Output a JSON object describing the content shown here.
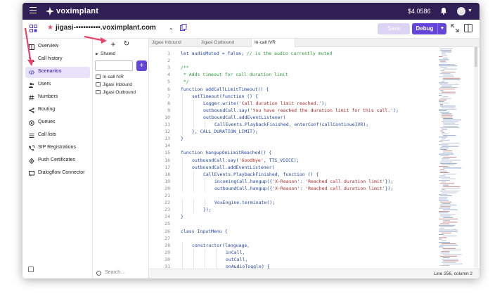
{
  "topbar": {
    "logo_text": "voximplant",
    "balance": "$4.0586"
  },
  "subbar": {
    "app_name": "jigasi-••••••••••.voximplant.com",
    "save_label": "Save",
    "debug_label": "Debug"
  },
  "sidebar": {
    "items": [
      {
        "label": "Overview",
        "icon": "overview-icon"
      },
      {
        "label": "Call history",
        "icon": "phone-icon"
      },
      {
        "label": "Scenarios",
        "icon": "code-icon",
        "active": true
      },
      {
        "label": "Users",
        "icon": "users-icon"
      },
      {
        "label": "Numbers",
        "icon": "numbers-icon"
      },
      {
        "label": "Routing",
        "icon": "routing-icon"
      },
      {
        "label": "Queues",
        "icon": "queues-icon"
      },
      {
        "label": "Call lists",
        "icon": "list-icon"
      },
      {
        "label": "SIP Registrations",
        "icon": "sip-icon"
      },
      {
        "label": "Push Certificates",
        "icon": "certificate-icon"
      },
      {
        "label": "Dialogflow Connector",
        "icon": "dialogflow-icon"
      }
    ]
  },
  "filetree": {
    "folder": "Shared",
    "files": [
      "In-call IVR",
      "Jigasi Inbound",
      "Jigasi Outbound"
    ],
    "search_placeholder": "Search..."
  },
  "tabs": [
    {
      "label": "Jigasi Inbound"
    },
    {
      "label": "Jigasi Outbound"
    },
    {
      "label": "In-call IVR",
      "active": true
    }
  ],
  "editor": {
    "lines": [
      {
        "n": "1",
        "indent": 0,
        "text": "let audioMuted = false; // is the audio currently muted"
      },
      {
        "n": "2",
        "indent": 0,
        "text": ""
      },
      {
        "n": "3",
        "indent": 0,
        "text": "/**"
      },
      {
        "n": "4",
        "indent": 0,
        "text": " * Adds timeout for call duration limit"
      },
      {
        "n": "5",
        "indent": 0,
        "text": " */"
      },
      {
        "n": "6",
        "indent": 0,
        "text": "function addCallLimitTimeout() {"
      },
      {
        "n": "7",
        "indent": 1,
        "text": "setTimeout(function () {"
      },
      {
        "n": "8",
        "indent": 2,
        "text": "Logger.write('Call duration limit reached.');"
      },
      {
        "n": "9",
        "indent": 2,
        "text": "outboundCall.say('You have reached the duration limit for this call.');"
      },
      {
        "n": "10",
        "indent": 2,
        "text": "outboundCall.addEventListener("
      },
      {
        "n": "11",
        "indent": 3,
        "text": "CallEvents.PlaybackFinished, enterConf(callContinueIVR);"
      },
      {
        "n": "12",
        "indent": 1,
        "text": "}, CALL_DURATION_LIMIT);"
      },
      {
        "n": "13",
        "indent": 0,
        "text": "}"
      },
      {
        "n": "14",
        "indent": 0,
        "text": ""
      },
      {
        "n": "15",
        "indent": 0,
        "text": "function hangupOnLimitReached() {"
      },
      {
        "n": "16",
        "indent": 1,
        "text": "outboundCall.say('Goodbye', TTS_VOICE);"
      },
      {
        "n": "17",
        "indent": 1,
        "text": "outboundCall.addEventListener("
      },
      {
        "n": "18",
        "indent": 2,
        "text": "CallEvents.PlaybackFinished, function () {"
      },
      {
        "n": "19",
        "indent": 3,
        "text": "incomingCall.hangup({'X-Reason': 'Reached call duration limit'});"
      },
      {
        "n": "20",
        "indent": 3,
        "text": "outboundCall.hangup({'X-Reason': 'Reached call duration limit'});"
      },
      {
        "n": "21",
        "indent": 0,
        "text": ""
      },
      {
        "n": "22",
        "indent": 3,
        "text": "VoxEngine.terminate();"
      },
      {
        "n": "23",
        "indent": 2,
        "text": "});"
      },
      {
        "n": "24",
        "indent": 0,
        "text": "}"
      },
      {
        "n": "25",
        "indent": 0,
        "text": ""
      },
      {
        "n": "26",
        "indent": 0,
        "text": "class InputMenu {"
      },
      {
        "n": "27",
        "indent": 0,
        "text": ""
      },
      {
        "n": "28",
        "indent": 1,
        "text": "constructor(language,"
      },
      {
        "n": "29",
        "indent": 4,
        "text": "inCall,"
      },
      {
        "n": "30",
        "indent": 4,
        "text": "outCall,"
      },
      {
        "n": "31",
        "indent": 4,
        "text": "onAudioToggle) {"
      }
    ]
  },
  "status": {
    "position": "Line 256, column 2"
  },
  "colors": {
    "topbar": "#2f1f55",
    "accent": "#6445d8",
    "annotation_arrow": "#e8416b"
  }
}
